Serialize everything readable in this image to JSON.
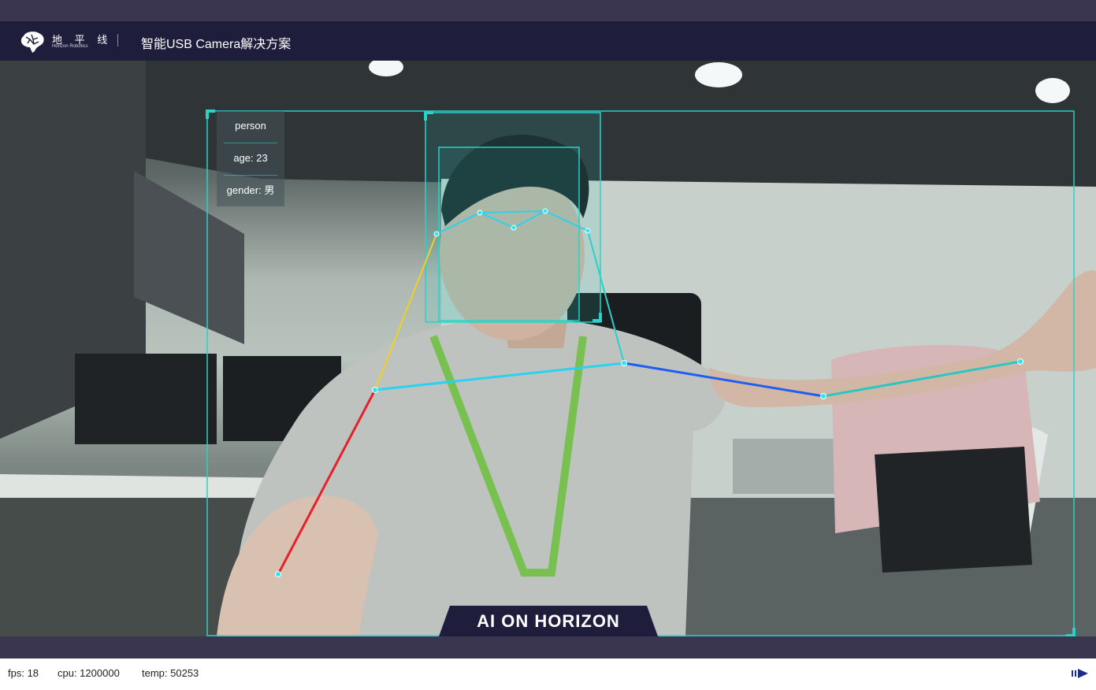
{
  "header": {
    "logo_cn": "地 平 线",
    "logo_en": "Horizon Robotics",
    "title": "智能USB Camera解决方案"
  },
  "video": {
    "person_label": "person",
    "age_label": "age: 23",
    "gender_label": "gender: 男",
    "banner_text": "AI ON HORIZON"
  },
  "status": {
    "fps": "fps: 18",
    "cpu": "cpu: 1200000",
    "temp": "temp: 50253"
  },
  "icons": {
    "logo": "horizon-brain-logo-icon",
    "play": "play-icon"
  },
  "colors": {
    "header_bg": "#1e1e3c",
    "band_bg": "#3a3650",
    "box_cyan": "#28d2c8",
    "left_arm": "#e8202c",
    "left_shoulder": "#f0d020",
    "right_arm_upper": "#1e5ef0",
    "right_arm_lower": "#28c8c0",
    "shoulder_line": "#28d2f0",
    "play_icon": "#1e2a8c"
  }
}
